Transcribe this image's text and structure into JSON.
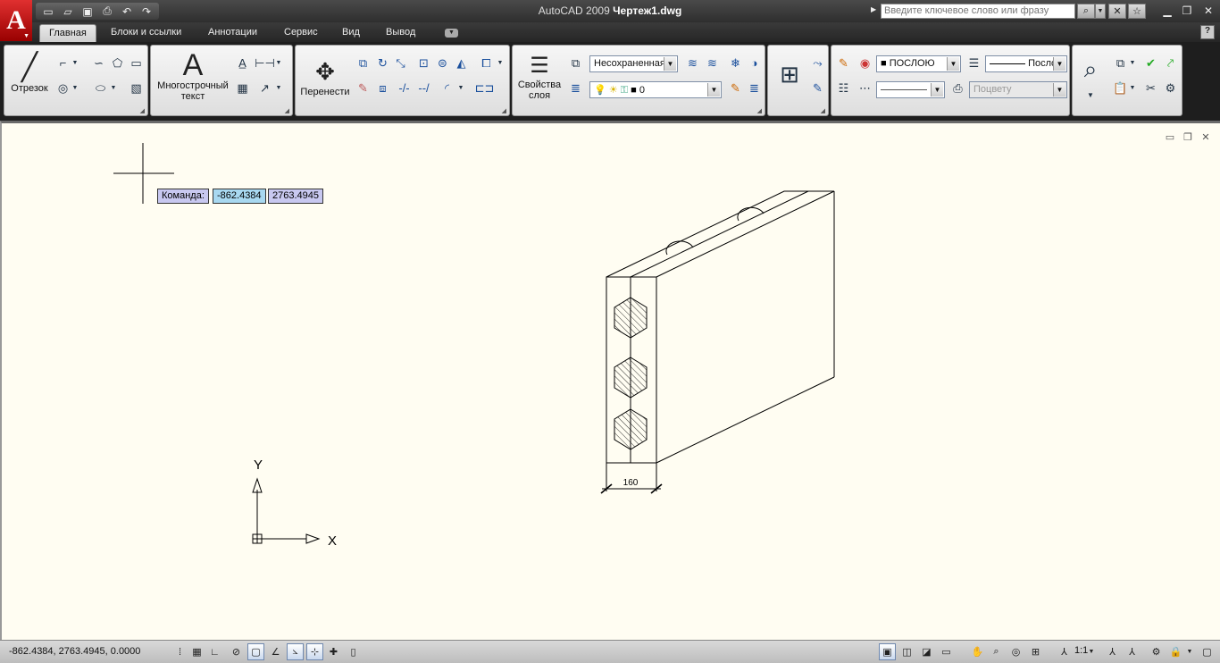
{
  "window": {
    "app_name": "AutoCAD 2009",
    "file_name": "Чертеж1.dwg",
    "logo_letter": "A",
    "help_search_placeholder": "Введите ключевое слово или фразу"
  },
  "quick_access": [
    "new-icon",
    "open-icon",
    "save-icon",
    "print-icon",
    "undo-icon",
    "redo-icon"
  ],
  "tabs": [
    {
      "label": "Главная",
      "active": true
    },
    {
      "label": "Блоки и ссылки",
      "active": false
    },
    {
      "label": "Аннотации",
      "active": false
    },
    {
      "label": "Сервис",
      "active": false
    },
    {
      "label": "Вид",
      "active": false
    },
    {
      "label": "Вывод",
      "active": false
    }
  ],
  "ribbon": {
    "draw": {
      "line_label": "Отрезок"
    },
    "annotation": {
      "mtext_label_1": "Многострочный",
      "mtext_label_2": "текст"
    },
    "modify": {
      "move_label": "Перенести"
    },
    "layers": {
      "properties_label_1": "Свойства",
      "properties_label_2": "слоя",
      "layer_state": "Несохраненная",
      "current_layer": "0"
    },
    "properties": {
      "color": "ПОСЛОЮ",
      "linetype": "Послo",
      "plotstyle": "Поцвету"
    }
  },
  "canvas": {
    "command_label": "Команда:",
    "coord_x": "-862.4384",
    "coord_y": "2763.4945",
    "dimension_value": "160",
    "ucs_x": "X",
    "ucs_y": "Y"
  },
  "status": {
    "coordinates": "-862.4384,  2763.4945, 0.0000",
    "annotation_scale": "1:1"
  },
  "colors": {
    "canvas_bg": "#fffdf2",
    "tooltip_bg": "#c8c8f0",
    "tooltip_active_bg": "#a8d8f0"
  }
}
